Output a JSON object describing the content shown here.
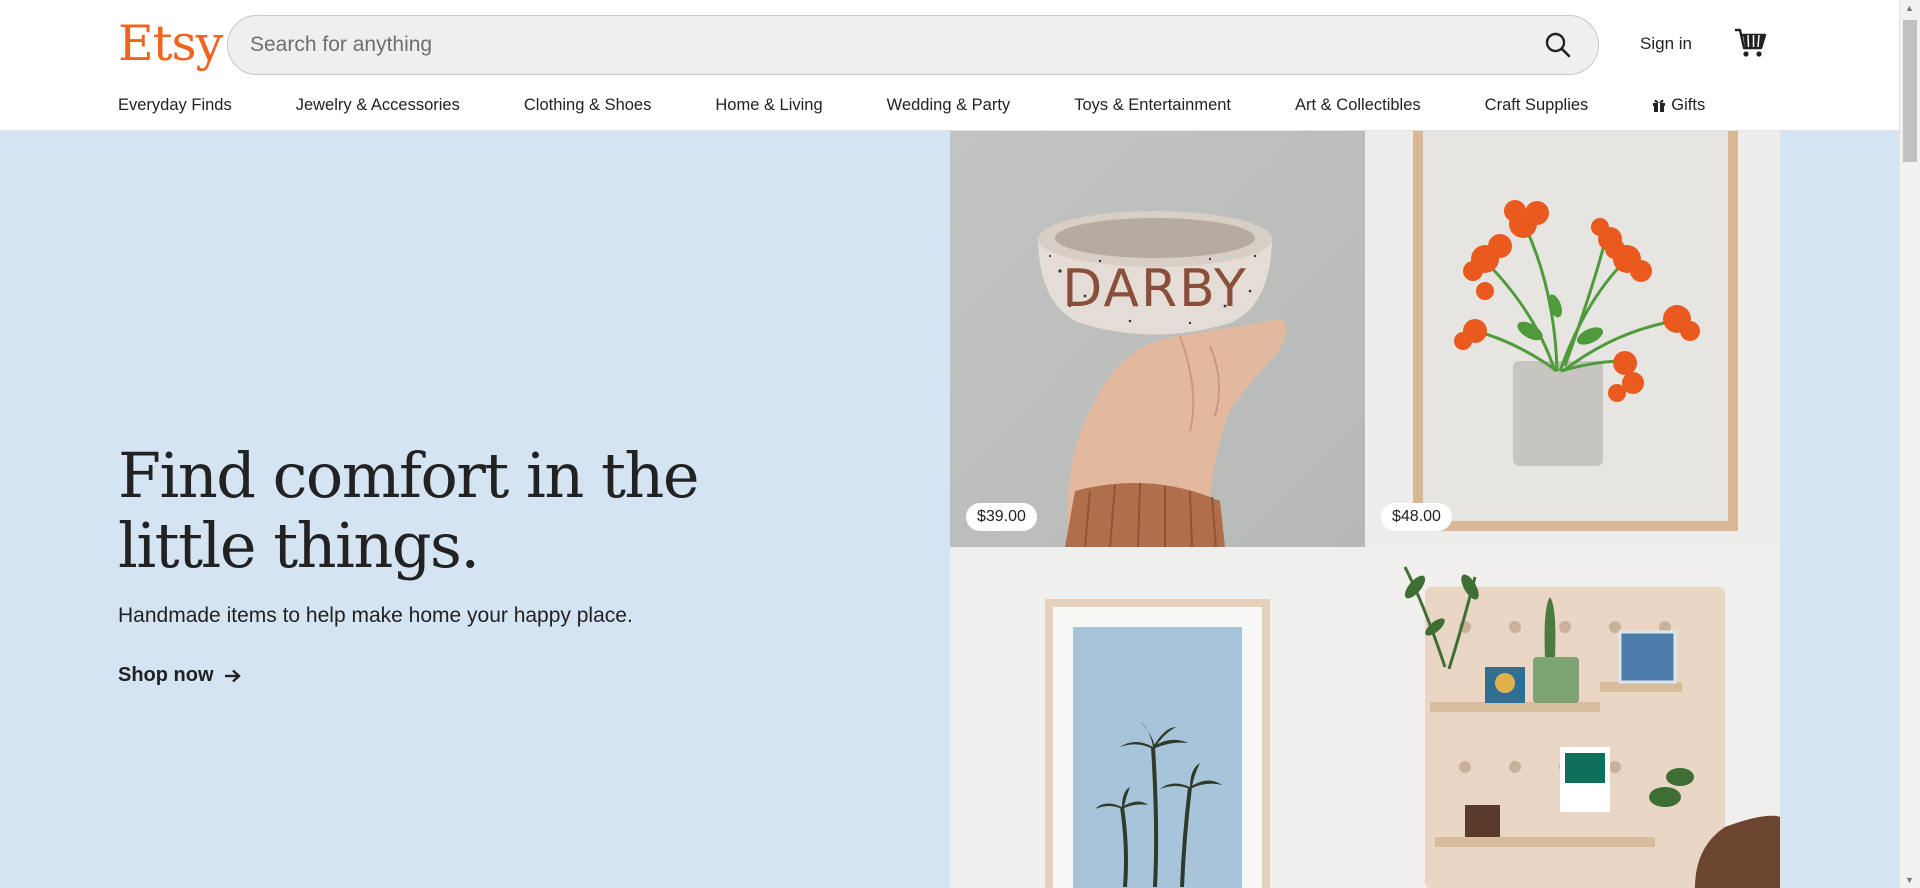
{
  "header": {
    "logo": "Etsy",
    "search_placeholder": "Search for anything",
    "signin": "Sign in"
  },
  "nav": {
    "items": [
      "Everyday Finds",
      "Jewelry & Accessories",
      "Clothing & Shoes",
      "Home & Living",
      "Wedding & Party",
      "Toys & Entertainment",
      "Art & Collectibles",
      "Craft Supplies",
      "Gifts"
    ]
  },
  "hero": {
    "title": "Find comfort in the little things.",
    "subtitle": "Handmade items to help make home your happy place.",
    "cta": "Shop now",
    "tiles": [
      {
        "price": "$39.00",
        "bowl_text": "DARBY"
      },
      {
        "price": "$48.00"
      },
      {},
      {}
    ]
  },
  "colors": {
    "brand": "#f1641e",
    "hero_bg": "#d5e4f3"
  }
}
